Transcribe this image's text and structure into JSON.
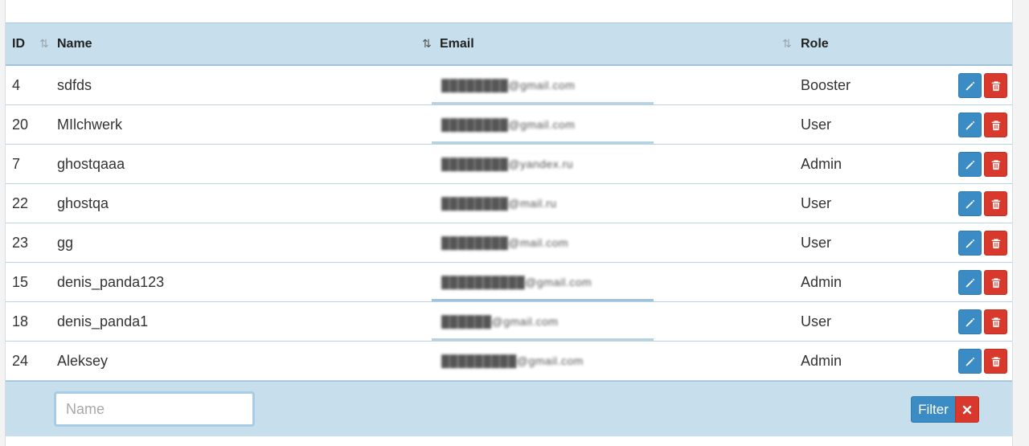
{
  "table": {
    "headers": {
      "id": "ID",
      "name": "Name",
      "email": "Email",
      "role": "Role"
    },
    "sort_icon": "sort-arrows-icon",
    "rows": [
      {
        "id": "4",
        "name": "sdfds",
        "email": "████████@gmail.com",
        "role": "Booster"
      },
      {
        "id": "20",
        "name": "MIlchwerk",
        "email": "████████@gmail.com",
        "role": "User"
      },
      {
        "id": "7",
        "name": "ghostqaaa",
        "email": "████████@yandex.ru",
        "role": "Admin"
      },
      {
        "id": "22",
        "name": "ghostqa",
        "email": "████████@mail.ru",
        "role": "User"
      },
      {
        "id": "23",
        "name": "gg",
        "email": "████████@mail.com",
        "role": "User"
      },
      {
        "id": "15",
        "name": "denis_panda123",
        "email": "██████████@gmail.com",
        "role": "Admin"
      },
      {
        "id": "18",
        "name": "denis_panda1",
        "email": "██████@gmail.com",
        "role": "User"
      },
      {
        "id": "24",
        "name": "Aleksey",
        "email": "█████████@gmail.com",
        "role": "Admin"
      }
    ],
    "row_actions": {
      "edit_icon": "pencil-icon",
      "delete_icon": "trash-icon"
    }
  },
  "filter": {
    "name_placeholder": "Name",
    "name_value": "",
    "filter_label": "Filter",
    "clear_icon": "close-icon"
  },
  "colors": {
    "header_bg": "#c7dfec",
    "edit_button": "#3b8cc5",
    "delete_button": "#d9392c"
  }
}
